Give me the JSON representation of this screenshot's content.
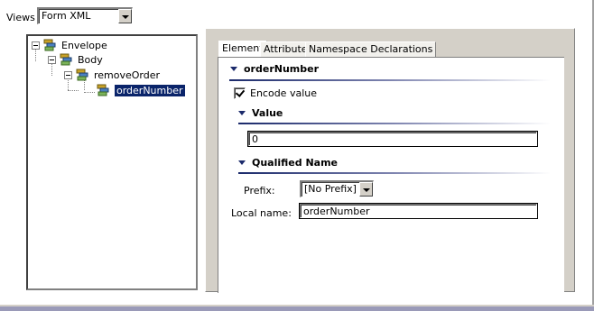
{
  "views": {
    "label": "Views",
    "selected": "Form XML"
  },
  "tree": {
    "nodes": [
      {
        "label": "Envelope",
        "icon": "element-node-icon"
      },
      {
        "label": "Body",
        "icon": "element-node-icon"
      },
      {
        "label": "removeOrder",
        "icon": "element-node-icon"
      },
      {
        "label": "orderNumber",
        "icon": "element-node-icon",
        "selected": true
      }
    ]
  },
  "tabs": [
    "Element",
    "Attributes",
    "Namespace Declarations"
  ],
  "active_tab": "Element",
  "element": {
    "header": "orderNumber",
    "encode_label": "Encode value",
    "encode_checked": true,
    "value_section": "Value",
    "value": "0",
    "qname_section": "Qualified Name",
    "prefix_label": "Prefix:",
    "prefix_value": "[No Prefix]",
    "local_name_label": "Local name:",
    "local_name_value": "orderNumber"
  },
  "colors": {
    "selection": "#0a246a",
    "section_accent": "#1b2a6b",
    "chrome": "#d4d0c8"
  }
}
